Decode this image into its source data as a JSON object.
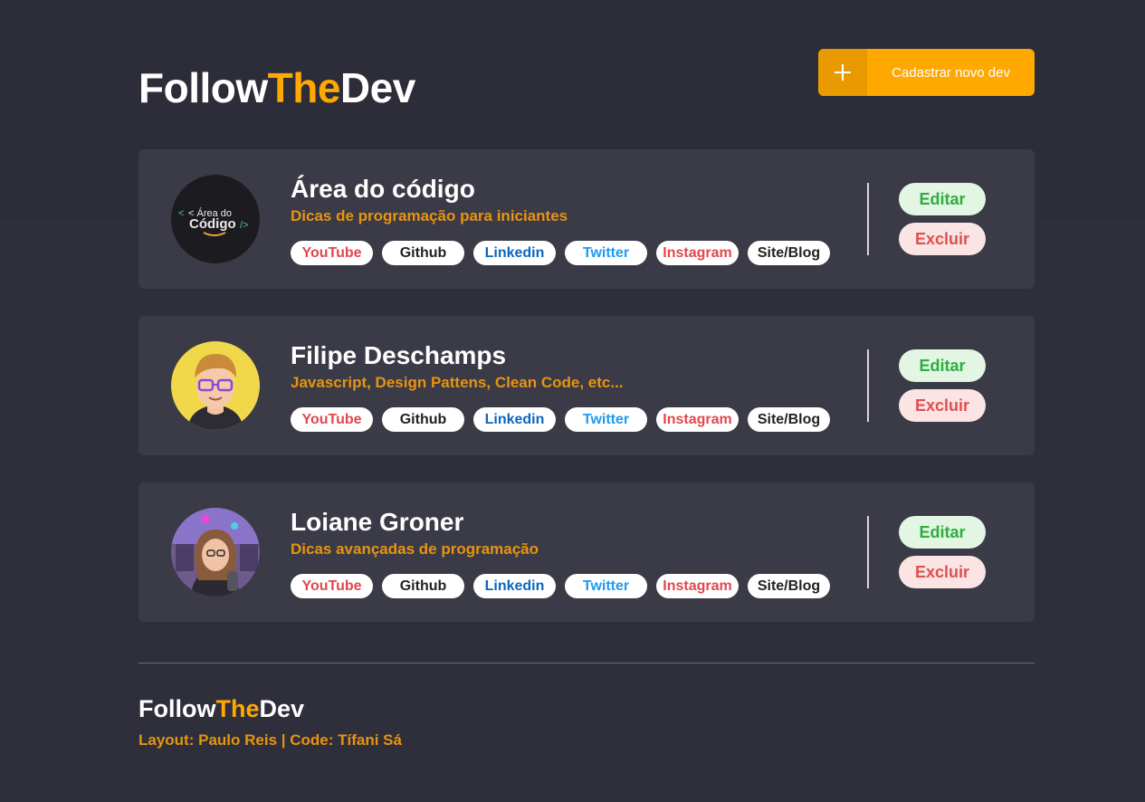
{
  "brand": {
    "prefix": "Follow",
    "accent": "The",
    "suffix": "Dev"
  },
  "add_button": {
    "label": "Cadastrar novo dev"
  },
  "colors": {
    "accent": "#ffa800",
    "card_bg": "#3a3b47",
    "youtube": "#e0484d",
    "github": "#222222",
    "linkedin": "#0a66c2",
    "twitter": "#1d9bf0",
    "instagram": "#e0484d",
    "site": "#222222"
  },
  "devs": [
    {
      "name": "Área do código",
      "description": "Dicas de programação para iniciantes",
      "avatar_text_1": "< Área do",
      "avatar_text_2": "Código />",
      "links": [
        "YouTube",
        "Github",
        "Linkedin",
        "Twitter",
        "Instagram",
        "Site/Blog"
      ],
      "edit_label": "Editar",
      "delete_label": "Excluir"
    },
    {
      "name": "Filipe Deschamps",
      "description": "Javascript, Design Pattens, Clean Code, etc...",
      "links": [
        "YouTube",
        "Github",
        "Linkedin",
        "Twitter",
        "Instagram",
        "Site/Blog"
      ],
      "edit_label": "Editar",
      "delete_label": "Excluir"
    },
    {
      "name": "Loiane Groner",
      "description": "Dicas avançadas de programação",
      "links": [
        "YouTube",
        "Github",
        "Linkedin",
        "Twitter",
        "Instagram",
        "Site/Blog"
      ],
      "edit_label": "Editar",
      "delete_label": "Excluir"
    }
  ],
  "footer": {
    "credit": "Layout: Paulo Reis | Code: Tífani Sá"
  }
}
